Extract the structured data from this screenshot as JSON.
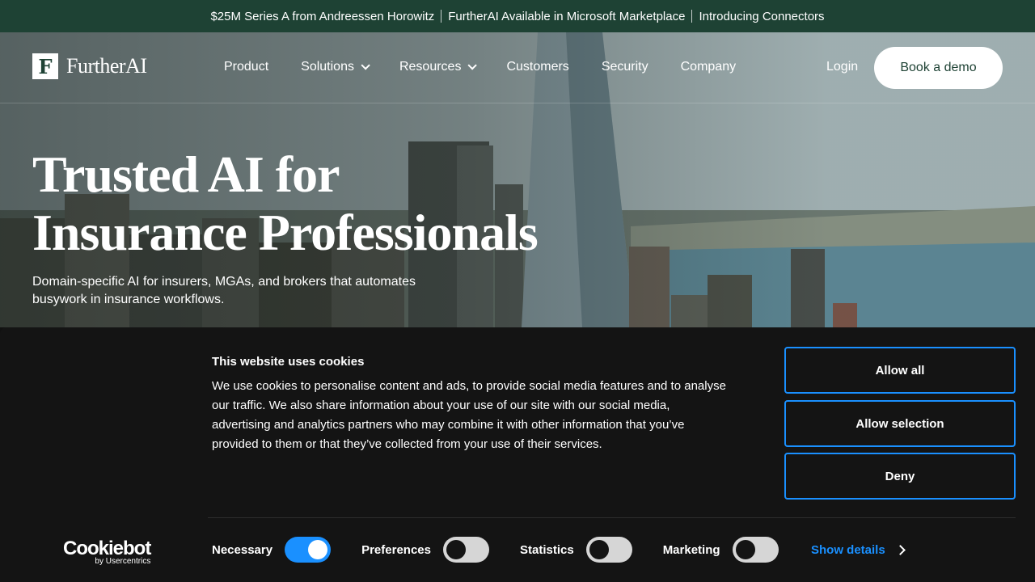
{
  "announcement": {
    "items": [
      "$25M Series A from Andreessen Horowitz",
      "FurtherAI Available in Microsoft Marketplace",
      "Introducing Connectors"
    ]
  },
  "brand": {
    "mark": "F",
    "name": "FurtherAI",
    "color": "#1e4234"
  },
  "nav": {
    "items": [
      {
        "label": "Product"
      },
      {
        "label": "Solutions"
      },
      {
        "label": "Resources"
      },
      {
        "label": "Customers"
      },
      {
        "label": "Security"
      },
      {
        "label": "Company"
      }
    ],
    "login": "Login",
    "cta": "Book a demo"
  },
  "hero": {
    "headline_line1": "Trusted AI for",
    "headline_line2": "Insurance Professionals",
    "subhead": "Domain-specific AI for insurers, MGAs, and brokers that automates busywork in insurance workflows."
  },
  "cookie": {
    "title": "This website uses cookies",
    "text": "We use cookies to personalise content and ads, to provide social media features and to analyse our traffic. We also share information about your use of our site with our social media, advertising and analytics partners who may combine it with other information that you’ve provided to them or that they’ve collected from your use of their services.",
    "buttons": {
      "allow_all": "Allow all",
      "allow_selection": "Allow selection",
      "deny": "Deny"
    },
    "toggles": [
      {
        "label": "Necessary",
        "on": true
      },
      {
        "label": "Preferences",
        "on": false
      },
      {
        "label": "Statistics",
        "on": false
      },
      {
        "label": "Marketing",
        "on": false
      }
    ],
    "show_details": "Show details",
    "cookiebot": {
      "name": "Cookiebot",
      "by": "by Usercentrics"
    },
    "accent": "#1a90ff"
  }
}
